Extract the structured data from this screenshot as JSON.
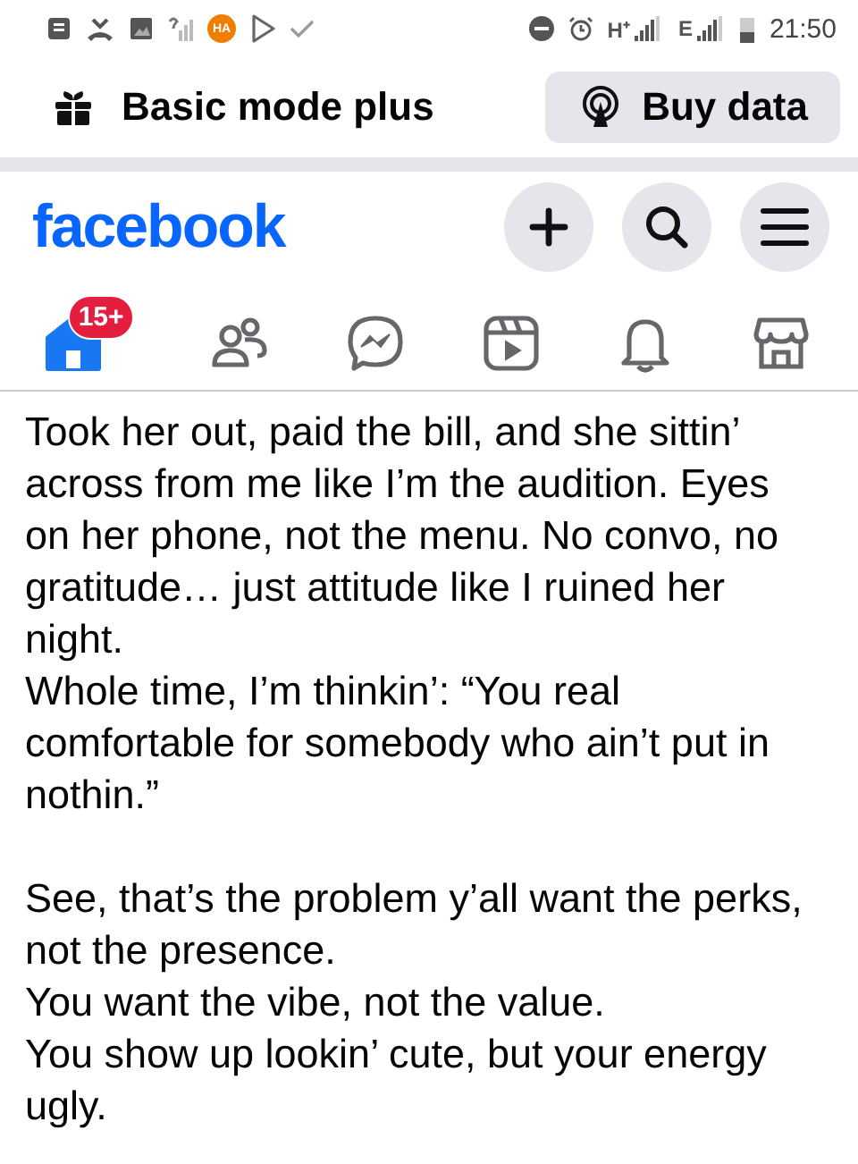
{
  "status_bar": {
    "app_badge": "HA",
    "network_1": "H⁺",
    "network_2": "E",
    "time": "21:50"
  },
  "mode_bar": {
    "label": "Basic mode plus",
    "button": "Buy data"
  },
  "header": {
    "logo": "facebook"
  },
  "tabs": [
    {
      "kind": "home",
      "selected": true,
      "badge": "15+"
    },
    {
      "kind": "friends",
      "selected": false
    },
    {
      "kind": "messenger",
      "selected": false
    },
    {
      "kind": "video",
      "selected": false
    },
    {
      "kind": "notifications",
      "selected": false
    },
    {
      "kind": "marketplace",
      "selected": false
    }
  ],
  "post": {
    "blocks": [
      [
        "Took her out, paid the bill, and she sittin’ across from me like I’m the audition. Eyes on her phone, not the menu. No convo, no gratitude… just attitude like I ruined her night.",
        "Whole time, I’m thinkin’: “You real comfortable for somebody who ain’t put in nothin.”"
      ],
      [
        "See, that’s the problem y’all want the perks, not the presence.",
        "You want the vibe, not the value.",
        "You show up lookin’ cute, but your energy ugly."
      ]
    ]
  }
}
